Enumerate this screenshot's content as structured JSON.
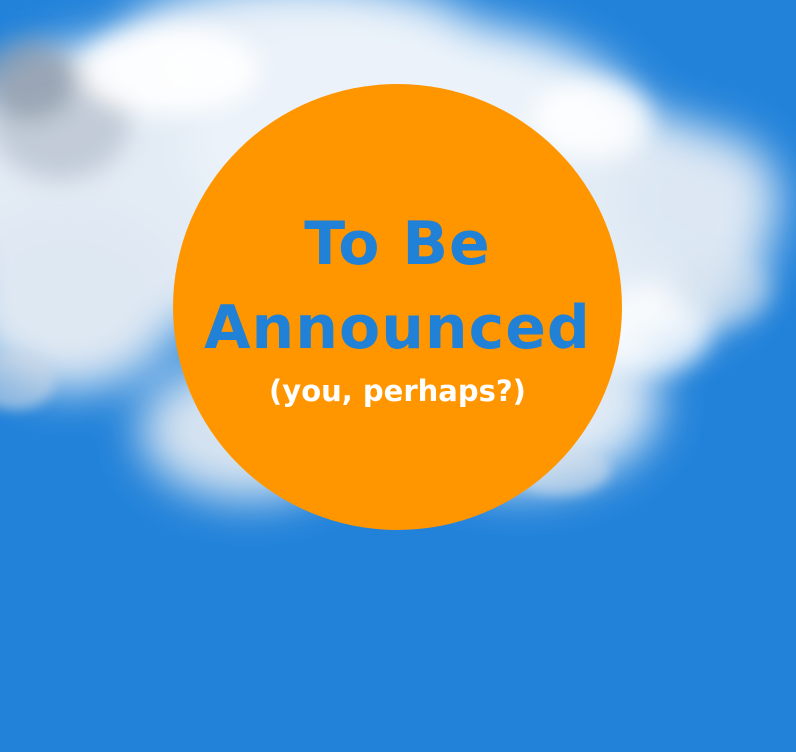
{
  "badge": {
    "line1": "To Be",
    "line2": "Announced",
    "subtitle": "(you, perhaps?)"
  },
  "colors": {
    "sky": "#2282d9",
    "badge": "#ff9600",
    "headline": "#2081d6",
    "subtitle": "#ffffff"
  }
}
